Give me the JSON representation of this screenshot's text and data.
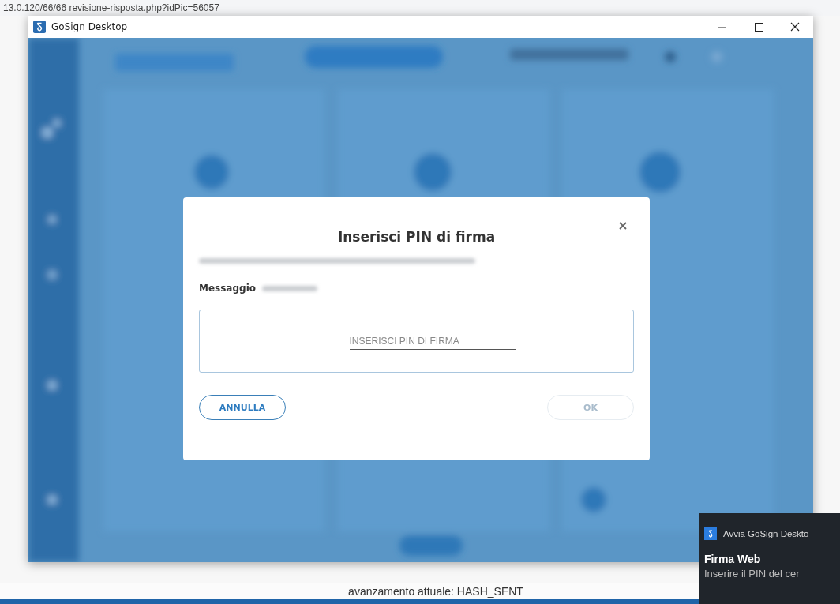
{
  "browser": {
    "address": "13.0.120/66/66 revisione-risposta.php?idPic=56057"
  },
  "window": {
    "title": "GoSign Desktop"
  },
  "dialog": {
    "title": "Inserisci PIN di firma",
    "message_label": "Messaggio",
    "pin_field": {
      "placeholder": "INSERISCI PIN DI FIRMA"
    },
    "buttons": [
      {
        "label": "ANNULLA",
        "disabled": false
      },
      {
        "label": "OK",
        "disabled": true
      }
    ]
  },
  "status_bar": {
    "text": "avanzamento attuale: HASH_SENT"
  },
  "notification": {
    "app": "Avvia GoSign Deskto",
    "title": "Firma Web",
    "body": "Inserire il PIN del cer"
  }
}
